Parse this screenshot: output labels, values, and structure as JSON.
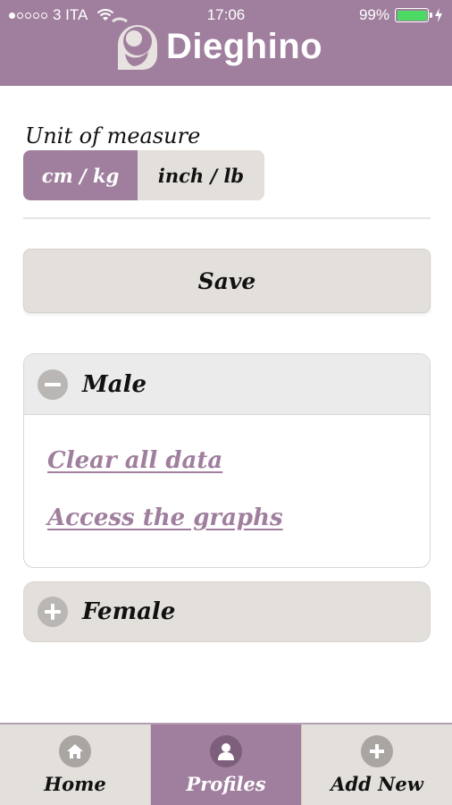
{
  "status_bar": {
    "carrier": "3 ITA",
    "time": "17:06",
    "battery": "99%"
  },
  "header": {
    "app_name": "Dieghino"
  },
  "units": {
    "label": "Unit of measure",
    "options": [
      "cm / kg",
      "inch / lb"
    ],
    "selected": "cm / kg"
  },
  "save_label": "Save",
  "sections": {
    "male": {
      "title": "Male",
      "expanded": true,
      "links": {
        "clear": "Clear all data",
        "graphs": "Access the graphs"
      }
    },
    "female": {
      "title": "Female",
      "expanded": false
    }
  },
  "tabs": [
    {
      "label": "Home",
      "icon": "home-icon",
      "active": false
    },
    {
      "label": "Profiles",
      "icon": "profile-icon",
      "active": true
    },
    {
      "label": "Add New",
      "icon": "plus-icon",
      "active": false
    }
  ],
  "colors": {
    "brand": "#a07f9e",
    "surface": "#e3dfda",
    "battery": "#4cd964"
  }
}
